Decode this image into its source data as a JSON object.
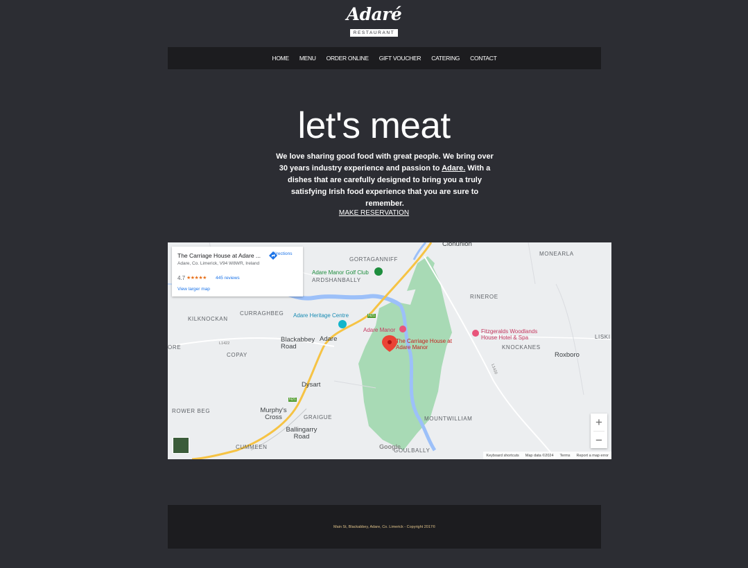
{
  "logo": {
    "script": "Adaré",
    "subtitle": "RESTAURANT"
  },
  "nav": {
    "items": [
      "HOME",
      "MENU",
      "ORDER ONLINE",
      "GIFT VOUCHER",
      "CATERING",
      "CONTACT"
    ]
  },
  "hero": {
    "title": "let's meat",
    "text_before": "We love sharing good food with great people. We bring over 30 years industry experience and passion to ",
    "text_link": "Adare.",
    "text_after": " With a dishes that are carefully designed to bring you a truly satisfying Irish food experience that you are sure to remember.",
    "cta": "MAKE RESERVATION"
  },
  "map": {
    "info_card": {
      "title": "The Carriage House at Adare ...",
      "address": "Adare, Co. Limerick, V94 W8WR, Ireland",
      "rating": "4.7",
      "stars": "★★★★★",
      "reviews": "445 reviews",
      "directions": "Directions",
      "larger_map": "View larger map"
    },
    "labels": {
      "clonunion": "Clonunion",
      "gortaganniff": "GORTAGANNIFF",
      "monearla": "MONEARLA",
      "golf_club": "Adare Manor Golf Club",
      "ardshanbally": "ARDSHANBALLY",
      "rineroe": "RINEROE",
      "curraghbeg": "CURRAGHBEG",
      "kilknockan": "KILKNOCKAN",
      "heritage_centre": "Adare Heritage Centre",
      "adare_manor": "Adare Manor",
      "fitzgeralds": "Fitzgeralds Woodlands House Hotel & Spa",
      "lisk": "LISKI",
      "carriage_house": "The Carriage House at Adare Manor",
      "blackabbey": "Blackabbey Road",
      "adare": "Adare",
      "knockanes": "KNOCKANES",
      "ore": "ORE",
      "copay": "COPAY",
      "roxboro": "Roxboro",
      "dysart": "Dysart",
      "rower_beg": "ROWER BEG",
      "murphys": "Murphy's Cross",
      "graigue": "GRAIGUE",
      "mountwilliam": "MOUNTWILLIAM",
      "ballingarry": "Ballingarry Road",
      "cummeen": "CUMMEEN",
      "goulbally": "GOULBALLY",
      "l1422": "L1422",
      "n21": "N21",
      "l1420": "L1420"
    },
    "zoom_in": "+",
    "zoom_out": "−",
    "google": "Google",
    "attribution": [
      "Keyboard shortcuts",
      "Map data ©2024",
      "Terms",
      "Report a map error"
    ],
    "colors": {
      "park": "#a8dab5",
      "water": "#9cc0f9",
      "highway": "#f6c344",
      "land": "#eceef0"
    }
  },
  "footer": {
    "text": "Main St, Blackabbey, Adare, Co. Limerick - Copyright 2017©"
  }
}
